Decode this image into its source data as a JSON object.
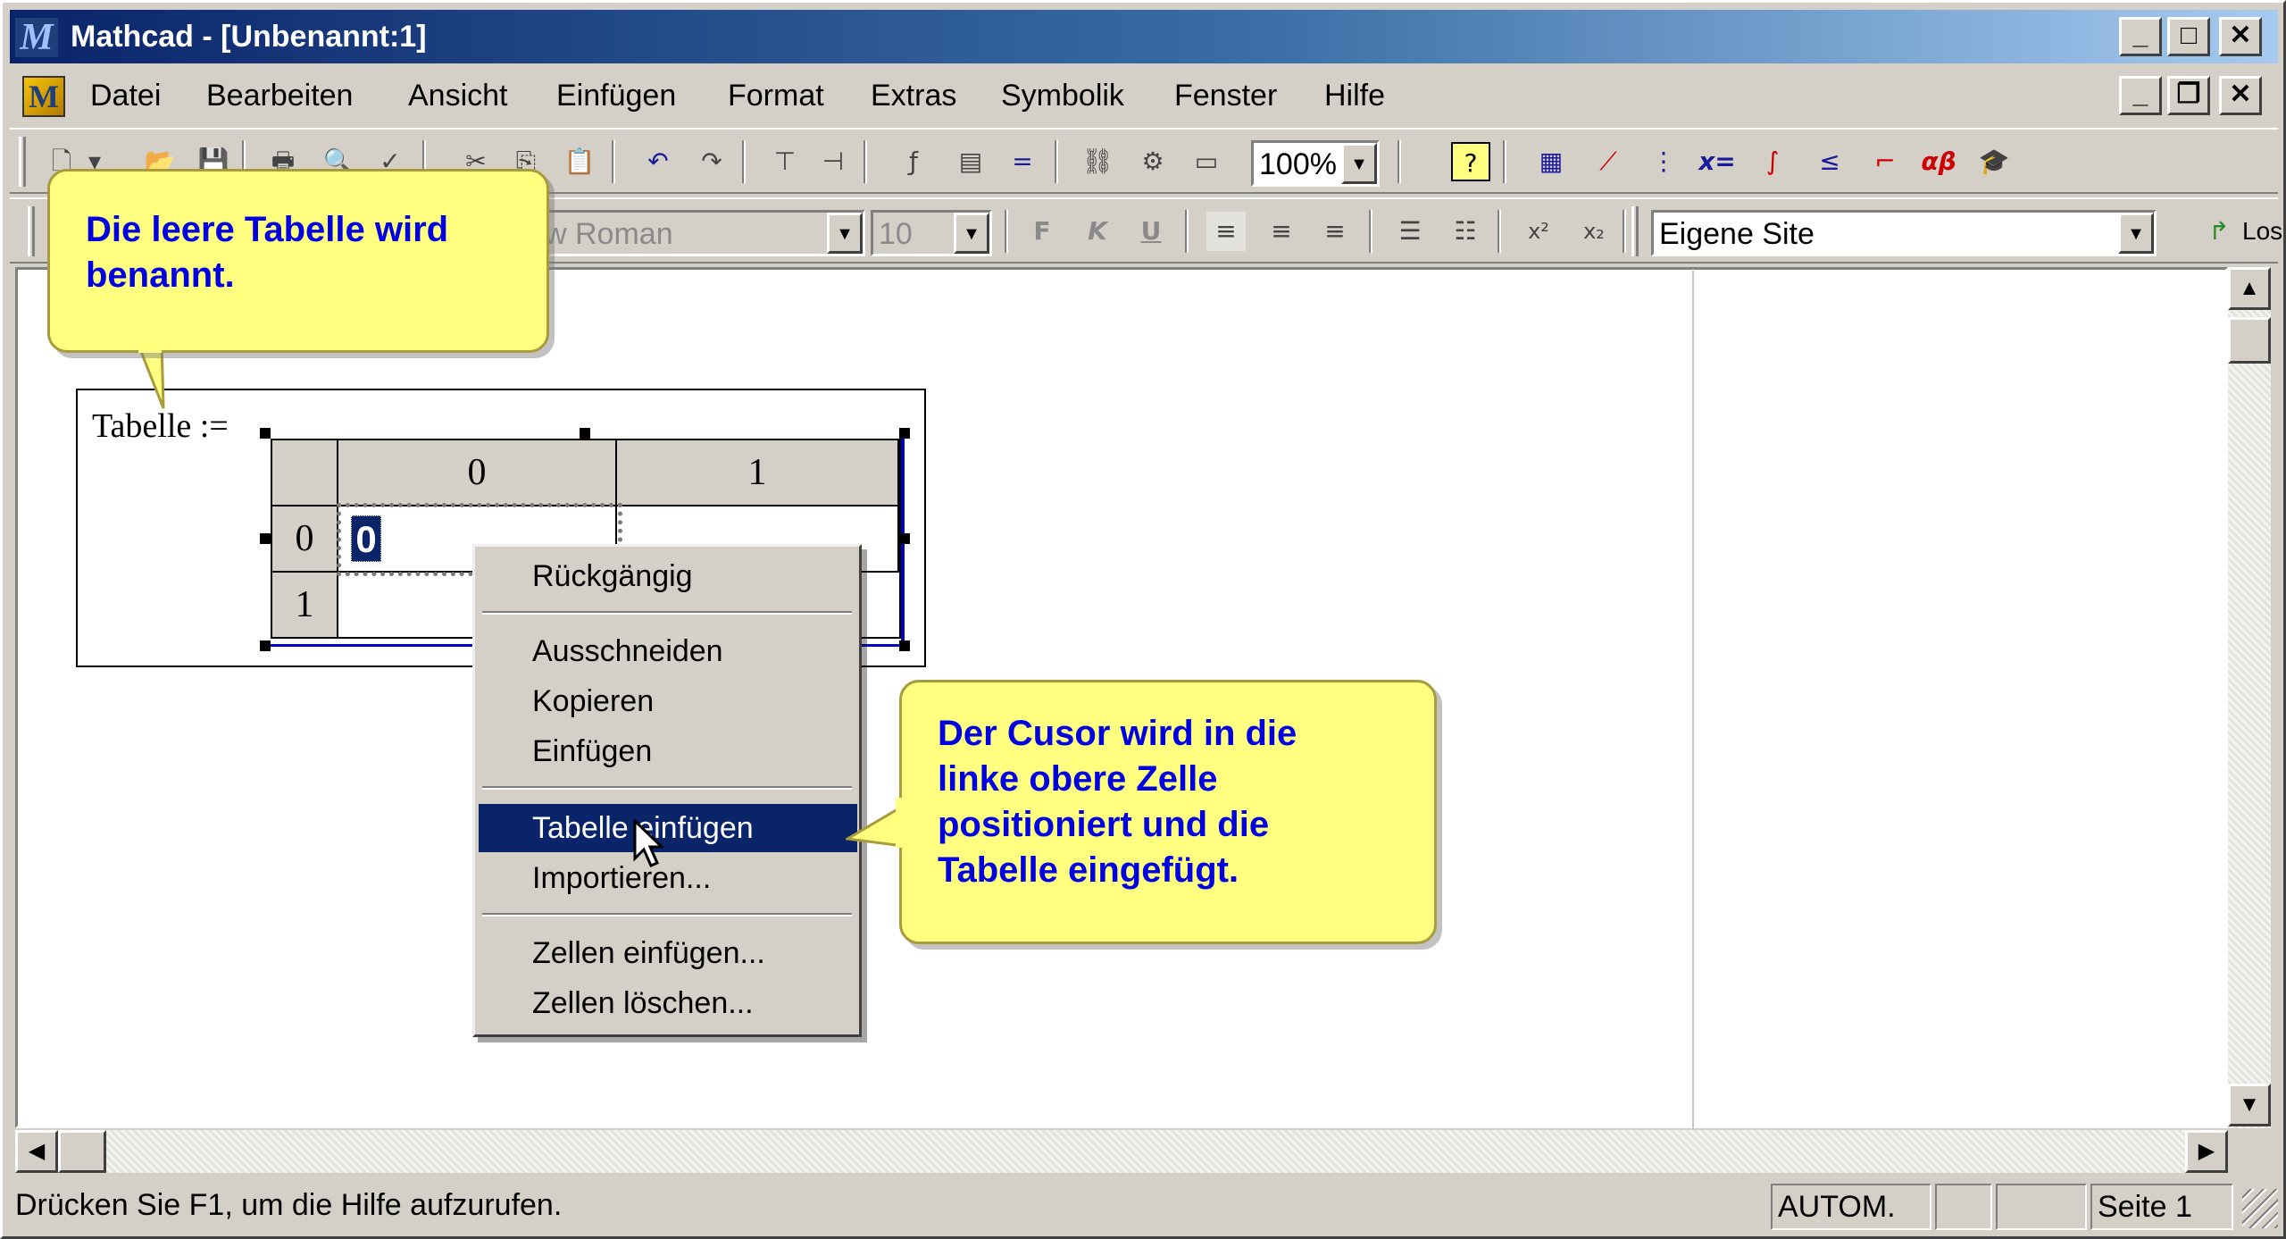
{
  "window": {
    "title": "Mathcad - [Unbenannt:1]",
    "logo": "M",
    "minimize": "_",
    "maximize": "□",
    "close": "✕",
    "restore": "❐"
  },
  "menu": [
    "Datei",
    "Bearbeiten",
    "Ansicht",
    "Einfügen",
    "Format",
    "Extras",
    "Symbolik",
    "Fenster",
    "Hilfe"
  ],
  "toolbar": {
    "zoom": "100%"
  },
  "format_bar": {
    "font": "w Roman",
    "size": "10",
    "bold": "F",
    "italic": "K",
    "underline": "U",
    "superscript": "x²",
    "subscript": "x₂",
    "site": "Eigene Site",
    "go_label": "Los"
  },
  "worksheet": {
    "label": "Tabelle :=",
    "columns": [
      "0",
      "1"
    ],
    "rows": [
      "0",
      "1"
    ],
    "cell_value": "0"
  },
  "context_menu": {
    "items": [
      "Rückgängig",
      "Ausschneiden",
      "Kopieren",
      "Einfügen",
      "Tabelle einfügen",
      "Importieren...",
      "Zellen einfügen...",
      "Zellen löschen..."
    ],
    "selected": "Tabelle einfügen"
  },
  "callouts": {
    "top_line1": "Die leere Tabelle wird",
    "top_line2": "benannt.",
    "bottom_line1": "Der Cusor wird in die",
    "bottom_line2": "linke obere Zelle",
    "bottom_line3": "positioniert und die",
    "bottom_line4": "Tabelle eingefügt."
  },
  "statusbar": {
    "help": "Drücken Sie F1, um die Hilfe aufzurufen.",
    "mode": "AUTOM.",
    "page": "Seite 1"
  },
  "colors": {
    "titlebar": "#0a246a",
    "callout": "#ffff80",
    "callout_text": "#0000e0",
    "selection": "#0a246a"
  }
}
